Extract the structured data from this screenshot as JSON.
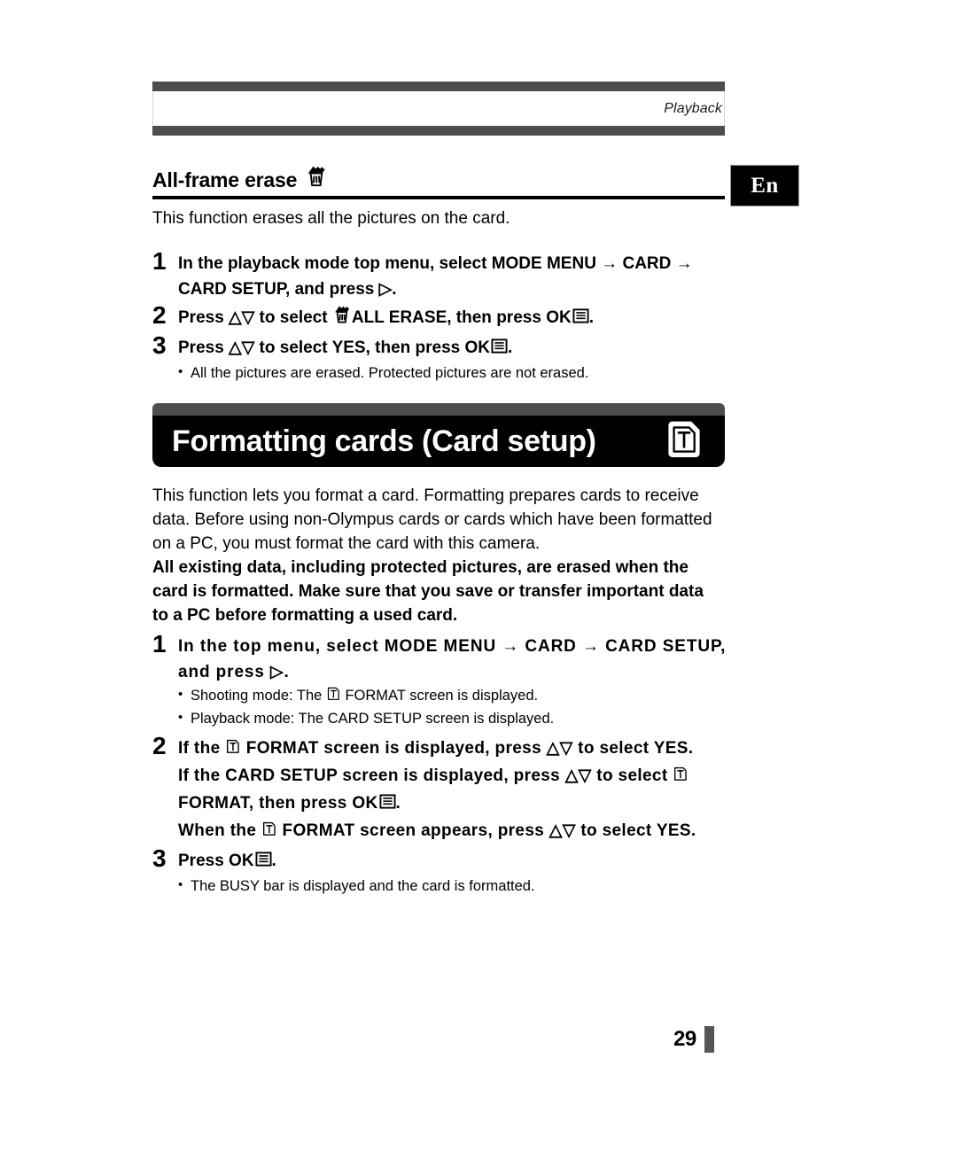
{
  "header": {
    "chapter": "Playback"
  },
  "language_tab": {
    "label": "En"
  },
  "section": {
    "heading": "All-frame erase",
    "heading_icon": "trash-can-icon",
    "intro": "This function erases all the pictures on the card.",
    "steps": [
      {
        "number": "1",
        "lines": [
          "In the playback mode top menu, select MODE MENU → CARD →",
          "CARD SETUP, and press ▷."
        ]
      },
      {
        "number": "2",
        "lines": [
          "Press △▽ to select  \u0000trash\u0000 ALL ERASE, then press  \u0000ok\u0000 ."
        ]
      },
      {
        "number": "3",
        "lines": [
          "Press △▽ to select YES, then press  \u0000ok\u0000 ."
        ]
      }
    ],
    "notes": [
      "All the pictures are erased. Protected pictures are not erased."
    ],
    "step2_text_a": "Press △▽ to select ",
    "step2_text_b": "ALL ERASE, then press ",
    "step2_text_c": ".",
    "step3_text_a": "Press △▽ to select YES, then press ",
    "step3_text_c": "."
  },
  "title_bar": {
    "title": "Formatting cards (Card setup)",
    "icon": "card-icon"
  },
  "body": {
    "paragraphs": [
      {
        "bold": false,
        "lines": [
          "This function lets you format a card. Formatting prepares cards to receive",
          "data. Before using non-Olympus cards or cards which have been formatted",
          "on a PC, you must format the card with this camera."
        ]
      },
      {
        "bold": true,
        "lines": [
          "All existing data, including protected pictures, are erased when the",
          "card is formatted. Make sure that you save or transfer important data",
          "to a PC before formatting a used card."
        ]
      }
    ]
  },
  "steps_format": {
    "step1": {
      "number": "1",
      "line1": "In the top menu, select MODE MENU → CARD → CARD SETUP,",
      "line2": "and press ▷.",
      "notes": [
        {
          "prefix": "Shooting mode: The ",
          "icon": "card-icon",
          "suffix": " FORMAT screen is displayed."
        },
        {
          "prefix": "Playback mode: The CARD SETUP screen is displayed.",
          "icon": "",
          "suffix": ""
        }
      ]
    },
    "step2": {
      "number": "2",
      "l1a": "If the ",
      "l1b": " FORMAT screen is displayed, press △▽ to select YES.",
      "l2a": "If the CARD SETUP screen is displayed, press △▽ to select ",
      "l3a": "FORMAT, then press ",
      "l3c": ".",
      "l4a": "When the ",
      "l4b": " FORMAT screen appears, press △▽ to select YES."
    },
    "step3": {
      "number": "3",
      "l1a": "Press ",
      "l1c": ".",
      "notes": [
        "The BUSY bar is displayed and the card is formatted."
      ]
    }
  },
  "ok_button": {
    "label": "OK",
    "glyph": "menu-list-icon"
  },
  "footer": {
    "page_number": "29"
  },
  "colors": {
    "rule_gray": "#4d4d4d",
    "title_black": "#000000",
    "page_marker": "#555555"
  }
}
